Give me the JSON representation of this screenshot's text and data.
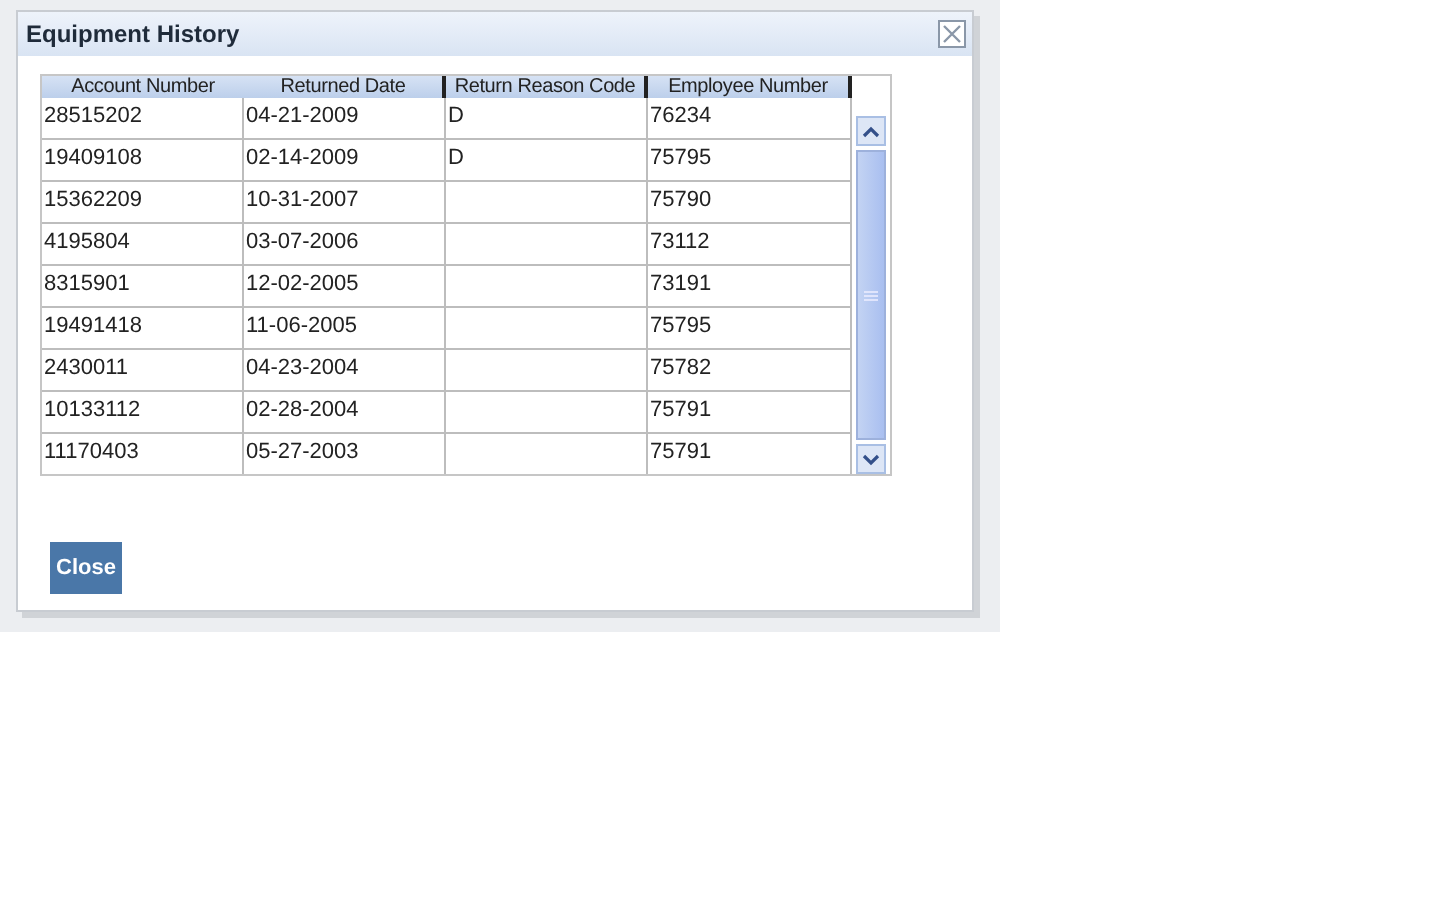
{
  "dialog": {
    "title": "Equipment History",
    "close_button": "Close"
  },
  "table": {
    "columns": [
      "Account Number",
      "Returned Date",
      "Return Reason Code",
      "Employee Number"
    ],
    "rows": [
      {
        "cells": [
          "28515202",
          "04-21-2009",
          "D",
          "76234"
        ]
      },
      {
        "cells": [
          "19409108",
          "02-14-2009",
          "D",
          "75795"
        ]
      },
      {
        "cells": [
          "15362209",
          "10-31-2007",
          null,
          "75790"
        ]
      },
      {
        "cells": [
          "4195804",
          "03-07-2006",
          null,
          "73112"
        ]
      },
      {
        "cells": [
          "8315901",
          "12-02-2005",
          null,
          "73191"
        ]
      },
      {
        "cells": [
          "19491418",
          "11-06-2005",
          null,
          "75795"
        ]
      },
      {
        "cells": [
          "2430011",
          "04-23-2004",
          null,
          "75782"
        ]
      },
      {
        "cells": [
          "10133112",
          "02-28-2004",
          null,
          "75791"
        ]
      },
      {
        "cells": [
          "11170403",
          "05-27-2003",
          null,
          "75791"
        ]
      }
    ]
  }
}
